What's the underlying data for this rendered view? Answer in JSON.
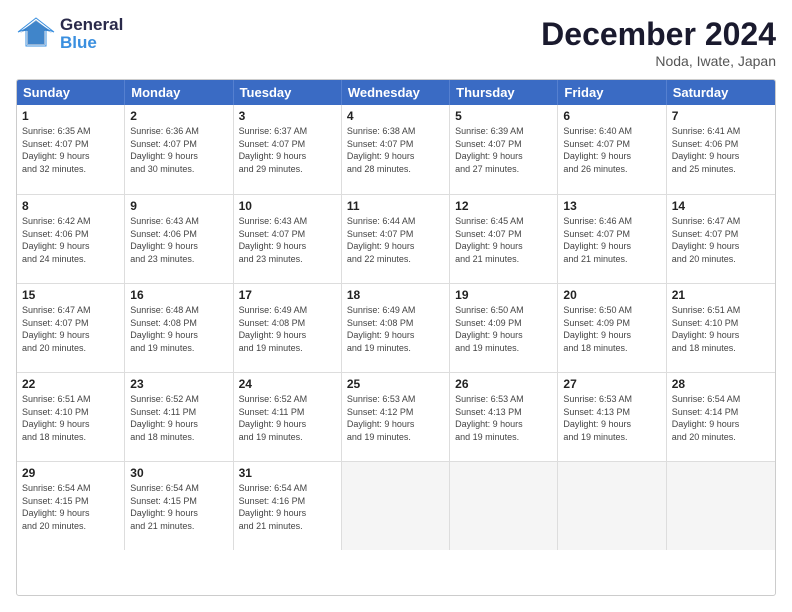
{
  "header": {
    "logo_general": "General",
    "logo_blue": "Blue",
    "month_title": "December 2024",
    "location": "Noda, Iwate, Japan"
  },
  "days_of_week": [
    "Sunday",
    "Monday",
    "Tuesday",
    "Wednesday",
    "Thursday",
    "Friday",
    "Saturday"
  ],
  "weeks": [
    [
      {
        "day": "1",
        "info": "Sunrise: 6:35 AM\nSunset: 4:07 PM\nDaylight: 9 hours\nand 32 minutes."
      },
      {
        "day": "2",
        "info": "Sunrise: 6:36 AM\nSunset: 4:07 PM\nDaylight: 9 hours\nand 30 minutes."
      },
      {
        "day": "3",
        "info": "Sunrise: 6:37 AM\nSunset: 4:07 PM\nDaylight: 9 hours\nand 29 minutes."
      },
      {
        "day": "4",
        "info": "Sunrise: 6:38 AM\nSunset: 4:07 PM\nDaylight: 9 hours\nand 28 minutes."
      },
      {
        "day": "5",
        "info": "Sunrise: 6:39 AM\nSunset: 4:07 PM\nDaylight: 9 hours\nand 27 minutes."
      },
      {
        "day": "6",
        "info": "Sunrise: 6:40 AM\nSunset: 4:07 PM\nDaylight: 9 hours\nand 26 minutes."
      },
      {
        "day": "7",
        "info": "Sunrise: 6:41 AM\nSunset: 4:06 PM\nDaylight: 9 hours\nand 25 minutes."
      }
    ],
    [
      {
        "day": "8",
        "info": "Sunrise: 6:42 AM\nSunset: 4:06 PM\nDaylight: 9 hours\nand 24 minutes."
      },
      {
        "day": "9",
        "info": "Sunrise: 6:43 AM\nSunset: 4:06 PM\nDaylight: 9 hours\nand 23 minutes."
      },
      {
        "day": "10",
        "info": "Sunrise: 6:43 AM\nSunset: 4:07 PM\nDaylight: 9 hours\nand 23 minutes."
      },
      {
        "day": "11",
        "info": "Sunrise: 6:44 AM\nSunset: 4:07 PM\nDaylight: 9 hours\nand 22 minutes."
      },
      {
        "day": "12",
        "info": "Sunrise: 6:45 AM\nSunset: 4:07 PM\nDaylight: 9 hours\nand 21 minutes."
      },
      {
        "day": "13",
        "info": "Sunrise: 6:46 AM\nSunset: 4:07 PM\nDaylight: 9 hours\nand 21 minutes."
      },
      {
        "day": "14",
        "info": "Sunrise: 6:47 AM\nSunset: 4:07 PM\nDaylight: 9 hours\nand 20 minutes."
      }
    ],
    [
      {
        "day": "15",
        "info": "Sunrise: 6:47 AM\nSunset: 4:07 PM\nDaylight: 9 hours\nand 20 minutes."
      },
      {
        "day": "16",
        "info": "Sunrise: 6:48 AM\nSunset: 4:08 PM\nDaylight: 9 hours\nand 19 minutes."
      },
      {
        "day": "17",
        "info": "Sunrise: 6:49 AM\nSunset: 4:08 PM\nDaylight: 9 hours\nand 19 minutes."
      },
      {
        "day": "18",
        "info": "Sunrise: 6:49 AM\nSunset: 4:08 PM\nDaylight: 9 hours\nand 19 minutes."
      },
      {
        "day": "19",
        "info": "Sunrise: 6:50 AM\nSunset: 4:09 PM\nDaylight: 9 hours\nand 19 minutes."
      },
      {
        "day": "20",
        "info": "Sunrise: 6:50 AM\nSunset: 4:09 PM\nDaylight: 9 hours\nand 18 minutes."
      },
      {
        "day": "21",
        "info": "Sunrise: 6:51 AM\nSunset: 4:10 PM\nDaylight: 9 hours\nand 18 minutes."
      }
    ],
    [
      {
        "day": "22",
        "info": "Sunrise: 6:51 AM\nSunset: 4:10 PM\nDaylight: 9 hours\nand 18 minutes."
      },
      {
        "day": "23",
        "info": "Sunrise: 6:52 AM\nSunset: 4:11 PM\nDaylight: 9 hours\nand 18 minutes."
      },
      {
        "day": "24",
        "info": "Sunrise: 6:52 AM\nSunset: 4:11 PM\nDaylight: 9 hours\nand 19 minutes."
      },
      {
        "day": "25",
        "info": "Sunrise: 6:53 AM\nSunset: 4:12 PM\nDaylight: 9 hours\nand 19 minutes."
      },
      {
        "day": "26",
        "info": "Sunrise: 6:53 AM\nSunset: 4:13 PM\nDaylight: 9 hours\nand 19 minutes."
      },
      {
        "day": "27",
        "info": "Sunrise: 6:53 AM\nSunset: 4:13 PM\nDaylight: 9 hours\nand 19 minutes."
      },
      {
        "day": "28",
        "info": "Sunrise: 6:54 AM\nSunset: 4:14 PM\nDaylight: 9 hours\nand 20 minutes."
      }
    ],
    [
      {
        "day": "29",
        "info": "Sunrise: 6:54 AM\nSunset: 4:15 PM\nDaylight: 9 hours\nand 20 minutes."
      },
      {
        "day": "30",
        "info": "Sunrise: 6:54 AM\nSunset: 4:15 PM\nDaylight: 9 hours\nand 21 minutes."
      },
      {
        "day": "31",
        "info": "Sunrise: 6:54 AM\nSunset: 4:16 PM\nDaylight: 9 hours\nand 21 minutes."
      },
      {
        "day": "",
        "info": ""
      },
      {
        "day": "",
        "info": ""
      },
      {
        "day": "",
        "info": ""
      },
      {
        "day": "",
        "info": ""
      }
    ]
  ]
}
